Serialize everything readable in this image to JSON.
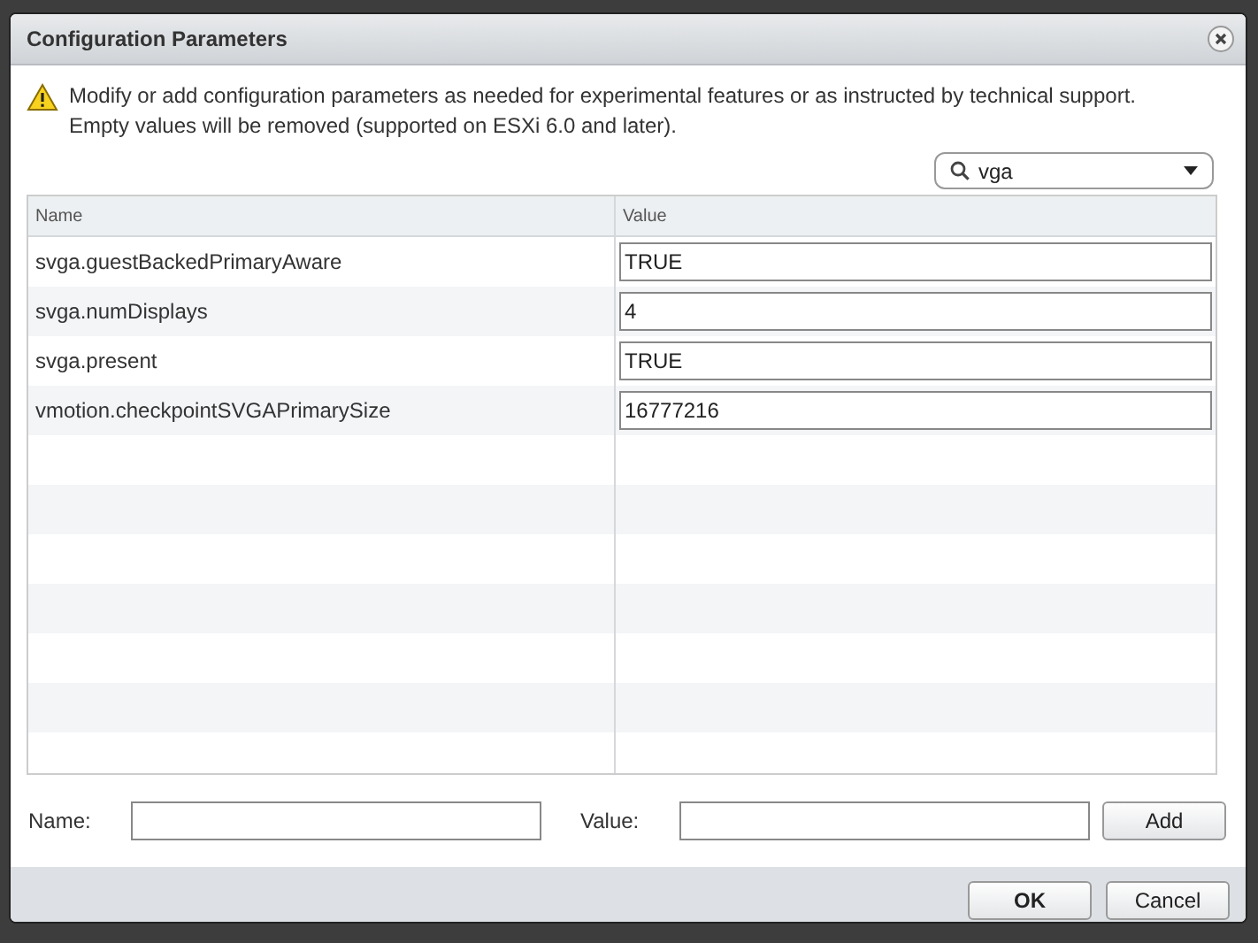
{
  "dialog": {
    "title": "Configuration Parameters"
  },
  "notice": {
    "lines": [
      "Modify or add configuration parameters as needed for experimental features or as instructed by technical support.",
      "Empty values will be removed (supported on ESXi 6.0 and later)."
    ]
  },
  "filter": {
    "value": "vga"
  },
  "table": {
    "columns": [
      "Name",
      "Value"
    ],
    "rows": [
      {
        "name": "svga.guestBackedPrimaryAware",
        "value": "TRUE"
      },
      {
        "name": "svga.numDisplays",
        "value": "4"
      },
      {
        "name": "svga.present",
        "value": "TRUE"
      },
      {
        "name": "vmotion.checkpointSVGAPrimarySize",
        "value": "16777216"
      }
    ]
  },
  "add_form": {
    "name_label": "Name:",
    "value_label": "Value:",
    "add_button": "Add"
  },
  "buttons": [
    "OK",
    "Cancel"
  ]
}
